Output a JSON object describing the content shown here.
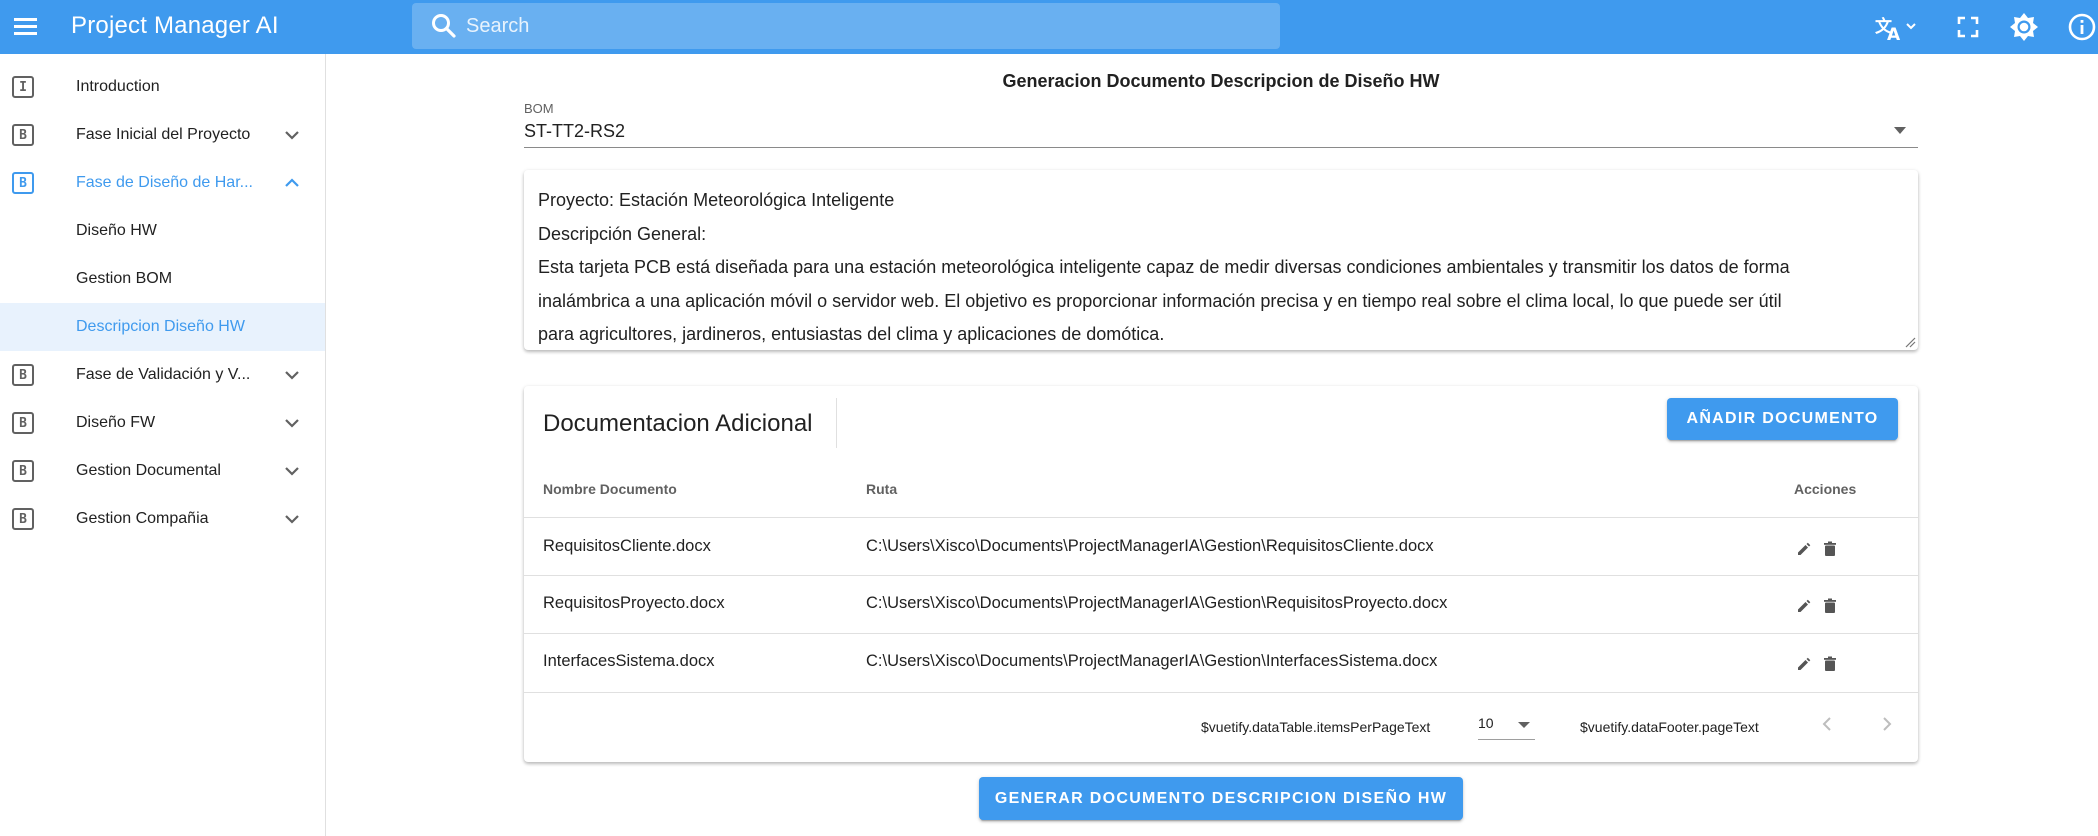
{
  "app": {
    "title": "Project Manager AI",
    "accent_color": "#3f9aee",
    "icons": [
      "menu-icon",
      "search-icon",
      "translate-icon",
      "fullscreen-icon",
      "brightness-icon",
      "info-icon"
    ]
  },
  "search": {
    "placeholder": "Search"
  },
  "sidebar": {
    "items": [
      {
        "badge": "I",
        "label": "Introduction",
        "expandable": false
      },
      {
        "badge": "B",
        "label": "Fase Inicial del Proyecto",
        "expandable": true
      },
      {
        "badge": "B",
        "label": "Fase de Diseño de Har...",
        "expandable": true,
        "expanded": true
      },
      {
        "label": "Diseño HW",
        "sub": true
      },
      {
        "label": "Gestion BOM",
        "sub": true
      },
      {
        "label": "Descripcion Diseño HW",
        "sub": true,
        "selected": true
      },
      {
        "badge": "B",
        "label": "Fase de Validación y V...",
        "expandable": true
      },
      {
        "badge": "B",
        "label": "Diseño FW",
        "expandable": true
      },
      {
        "badge": "B",
        "label": "Gestion Documental",
        "expandable": true
      },
      {
        "badge": "B",
        "label": "Gestion Compañia",
        "expandable": true
      }
    ]
  },
  "main": {
    "title": "Generacion Documento Descripcion de Diseño HW",
    "bom": {
      "label": "BOM",
      "value": "ST-TT2-RS2"
    },
    "description": {
      "lines": [
        "Proyecto: Estación Meteorológica Inteligente",
        "Descripción General:",
        "Esta tarjeta PCB está diseñada para una estación meteorológica inteligente capaz de medir diversas condiciones ambientales y transmitir los datos de forma",
        "inalámbrica a una aplicación móvil o servidor web. El objetivo es proporcionar información precisa y en tiempo real sobre el clima local, lo que puede ser útil",
        "para agricultores, jardineros, entusiastas del clima y aplicaciones de domótica."
      ]
    },
    "docs": {
      "title": "Documentacion Adicional",
      "add_button": "AÑADIR DOCUMENTO",
      "headers": {
        "name": "Nombre Documento",
        "path": "Ruta",
        "actions": "Acciones"
      },
      "rows": [
        {
          "name": "RequisitosCliente.docx",
          "path": "C:\\Users\\Xisco\\Documents\\ProjectManagerIA\\Gestion\\RequisitosCliente.docx"
        },
        {
          "name": "RequisitosProyecto.docx",
          "path": "C:\\Users\\Xisco\\Documents\\ProjectManagerIA\\Gestion\\RequisitosProyecto.docx"
        },
        {
          "name": "InterfacesSistema.docx",
          "path": "C:\\Users\\Xisco\\Documents\\ProjectManagerIA\\Gestion\\InterfacesSistema.docx"
        }
      ],
      "footer": {
        "items_per_page_text": "$vuetify.dataTable.itemsPerPageText",
        "items_per_page_value": "10",
        "page_text": "$vuetify.dataFooter.pageText"
      }
    },
    "generate_button": "GENERAR DOCUMENTO DESCRIPCION DISEÑO HW"
  }
}
